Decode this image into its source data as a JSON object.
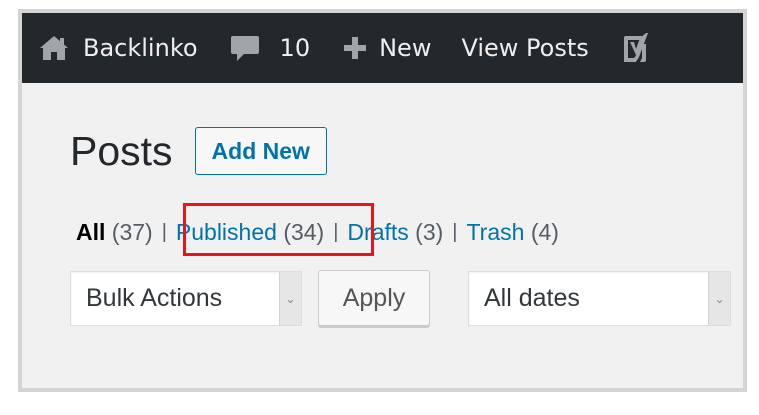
{
  "adminbar": {
    "site_icon": "home-icon",
    "site_name": "Backlinko",
    "comments_icon": "comment-bubble-icon",
    "comments_count": "10",
    "new_icon": "plus-icon",
    "new_label": "New",
    "view_posts_label": "View Posts",
    "yoast_icon": "yoast-logo-icon"
  },
  "page": {
    "title": "Posts",
    "add_new_label": "Add New"
  },
  "filters": {
    "all": {
      "label": "All",
      "count": "(37)"
    },
    "published": {
      "label": "Published",
      "count": "(34)"
    },
    "drafts": {
      "label": "Drafts",
      "count": "(3)"
    },
    "trash": {
      "label": "Trash",
      "count": "(4)"
    },
    "separator": "|"
  },
  "controls": {
    "bulk_actions_value": "Bulk Actions",
    "apply_label": "Apply",
    "dates_value": "All dates",
    "dropdown_arrow": "⌄"
  },
  "colors": {
    "adminbar_bg": "#23282d",
    "link": "#0073aa",
    "highlight_border": "#e8161b",
    "page_bg": "#f1f1f1"
  }
}
